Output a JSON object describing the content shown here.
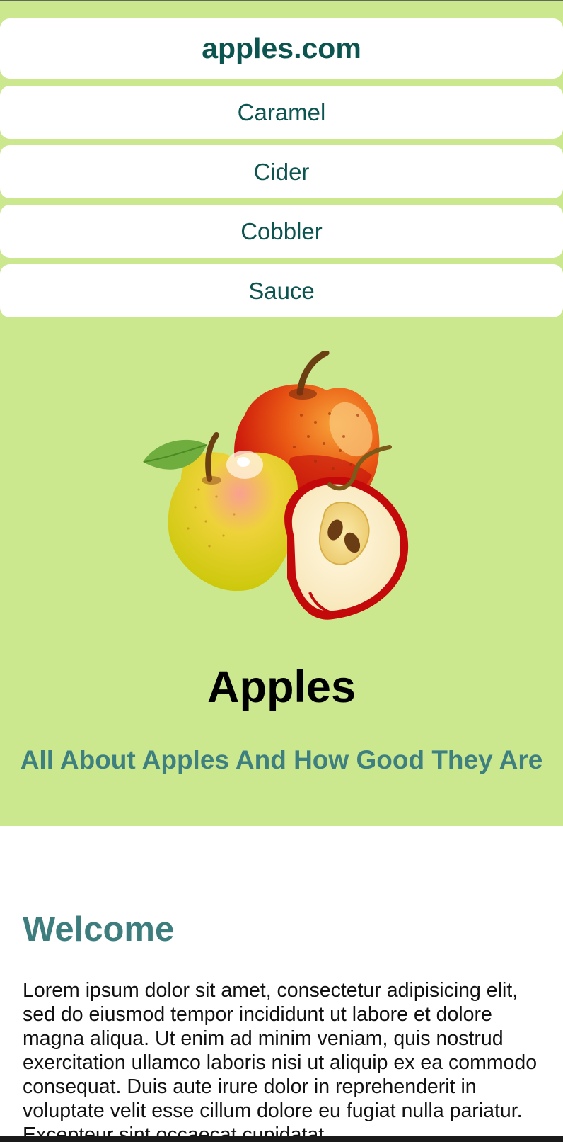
{
  "nav": {
    "brand": "apples.com",
    "links": [
      "Caramel",
      "Cider",
      "Cobbler",
      "Sauce"
    ]
  },
  "hero": {
    "image_icon": "apples-illustration",
    "title": "Apples",
    "subtitle": "All About Apples And How Good They Are"
  },
  "content": {
    "heading": "Welcome",
    "paragraph": "Lorem ipsum dolor sit amet, consectetur adipisicing elit, sed do eiusmod tempor incididunt ut labore et dolore magna aliqua. Ut enim ad minim veniam, quis nostrud exercitation ullamco laboris nisi ut aliquip ex ea commodo consequat. Duis aute irure dolor in reprehenderit in voluptate velit esse cillum dolore eu fugiat nulla pariatur. Excepteur sint occaecat cupidatat"
  },
  "colors": {
    "page_background": "#cbe88f",
    "nav_text": "#0c5450",
    "accent_teal": "#3e7f80",
    "content_background": "#ffffff"
  }
}
